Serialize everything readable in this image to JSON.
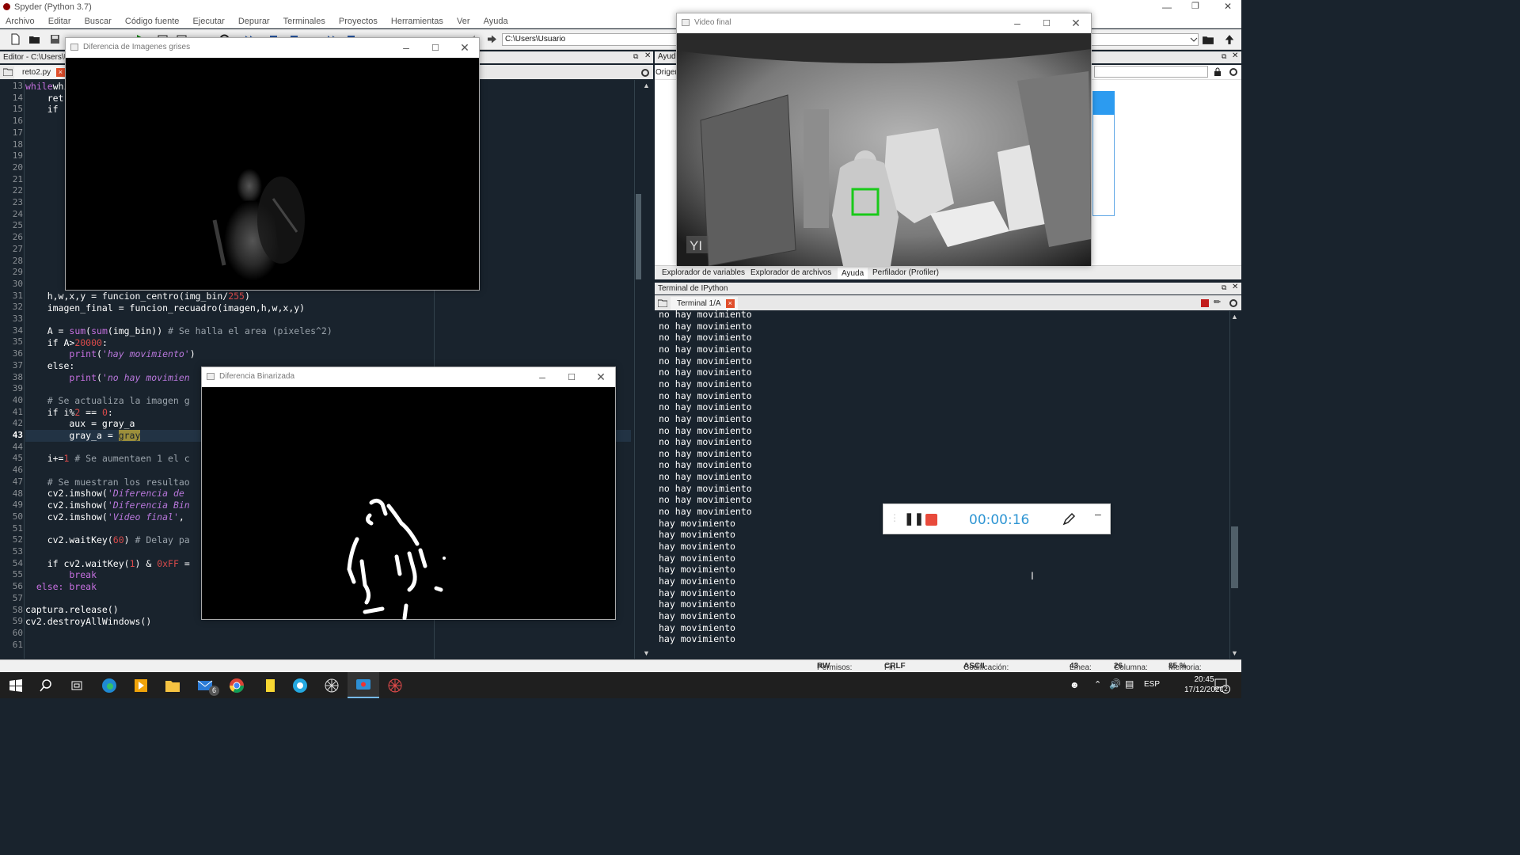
{
  "app": {
    "title": "Spyder (Python 3.7)",
    "menu": [
      "Archivo",
      "Editar",
      "Buscar",
      "Código fuente",
      "Ejecutar",
      "Depurar",
      "Terminales",
      "Proyectos",
      "Herramientas",
      "Ver",
      "Ayuda"
    ],
    "path": "C:\\Users\\Usuario"
  },
  "editor": {
    "header": "Editor - C:\\Users\\Us",
    "tab": "reto2.py",
    "current_line": 43,
    "line_numbers": [
      "13",
      "14",
      "15",
      "16",
      "17",
      "18",
      "19",
      "20",
      "21",
      "22",
      "23",
      "24",
      "25",
      "26",
      "27",
      "28",
      "29",
      "30",
      "31",
      "32",
      "33",
      "34",
      "35",
      "36",
      "37",
      "38",
      "39",
      "40",
      "41",
      "42",
      "43",
      "44",
      "45",
      "46",
      "47",
      "48",
      "49",
      "50",
      "51",
      "52",
      "53",
      "54",
      "55",
      "56",
      "57",
      "58",
      "59",
      "60",
      "61"
    ],
    "code": {
      "l13": "while(ca",
      "l14": "    ret,",
      "l15": "    if r",
      "l31": "    h,w,x,y = funcion_centro(img_bin/",
      "l31n": "255",
      "l31e": ")",
      "l32": "    imagen_final = funcion_recuadro(imagen,h,w,x,y)",
      "l34a": "    A = ",
      "l34b": "sum",
      "l34c": "(",
      "l34d": "sum",
      "l34e": "(img_bin)) ",
      "l34f": "# Se halla el area (pixeles^2)",
      "l35a": "    if A>",
      "l35b": "20000",
      "l35c": ":",
      "l36a": "        ",
      "l36b": "print",
      "l36c": "(",
      "l36d": "'hay movimiento'",
      "l36e": ")",
      "l37": "    else:",
      "l38a": "        ",
      "l38b": "print",
      "l38c": "(",
      "l38d": "'no hay movimien",
      "l40": "    # Se actualiza la imagen g",
      "l41a": "    if i%",
      "l41b": "2",
      "l41c": " == ",
      "l41d": "0",
      "l41e": ":",
      "l42": "        aux = gray_a",
      "l43a": "        gray_a = ",
      "l43b": "gray",
      "l45a": "    i+=",
      "l45b": "1",
      "l45c": " # Se aumentaen 1 el c",
      "l47": "    # Se muestran los resultao",
      "l48a": "    cv2.imshow(",
      "l48b": "'Diferencia de",
      "l49a": "    cv2.imshow(",
      "l49b": "'Diferencia Bin",
      "l50a": "    cv2.imshow(",
      "l50b": "'Video final'",
      "l50c": ",",
      "l52a": "    cv2.waitKey(",
      "l52b": "60",
      "l52c": ") ",
      "l52d": "# Delay pa",
      "l54a": "    if cv2.waitKey(",
      "l54b": "1",
      "l54c": ") & ",
      "l54d": "0xFF",
      "l54e": " =",
      "l55": "        break",
      "l56": "  else: break",
      "l58": "captura.release()",
      "l59": "cv2.destroyAllWindows()"
    }
  },
  "help_pane": {
    "header": "Ayuda",
    "source_label": "Origen"
  },
  "bottom_tabs": [
    "Explorador de variables",
    "Explorador de archivos",
    "Ayuda",
    "Perfilador (Profiler)"
  ],
  "terminal": {
    "header": "Terminal de IPython",
    "tab": "Terminal 1/A",
    "lines": [
      "no hay movimiento",
      "no hay movimiento",
      "no hay movimiento",
      "no hay movimiento",
      "no hay movimiento",
      "no hay movimiento",
      "no hay movimiento",
      "no hay movimiento",
      "no hay movimiento",
      "no hay movimiento",
      "no hay movimiento",
      "no hay movimiento",
      "no hay movimiento",
      "no hay movimiento",
      "no hay movimiento",
      "no hay movimiento",
      "no hay movimiento",
      "no hay movimiento",
      "hay movimiento",
      "hay movimiento",
      "hay movimiento",
      "hay movimiento",
      "hay movimiento",
      "hay movimiento",
      "hay movimiento",
      "hay movimiento",
      "hay movimiento",
      "hay movimiento",
      "hay movimiento"
    ]
  },
  "status": {
    "permisos_label": "Permisos:",
    "permisos": "RW",
    "eol_label": "Fin de línea:",
    "eol": "CRLF",
    "encoding_label": "Codificación:",
    "encoding": "ASCII",
    "line_label": "Línea:",
    "line": "43",
    "column_label": "Columna:",
    "column": "26",
    "memory_label": "Memoria:",
    "memory": "85 %"
  },
  "windows": {
    "grey": "Diferencia de Imagenes grises",
    "binary": "Diferencia Binarizada",
    "video": "Video final",
    "video_watermark": "YI"
  },
  "recorder": {
    "time": "00:00:16"
  },
  "taskbar": {
    "lang": "ESP",
    "time": "20:45",
    "date": "17/12/2020",
    "mail_badge": "6",
    "notif_badge": "2"
  }
}
